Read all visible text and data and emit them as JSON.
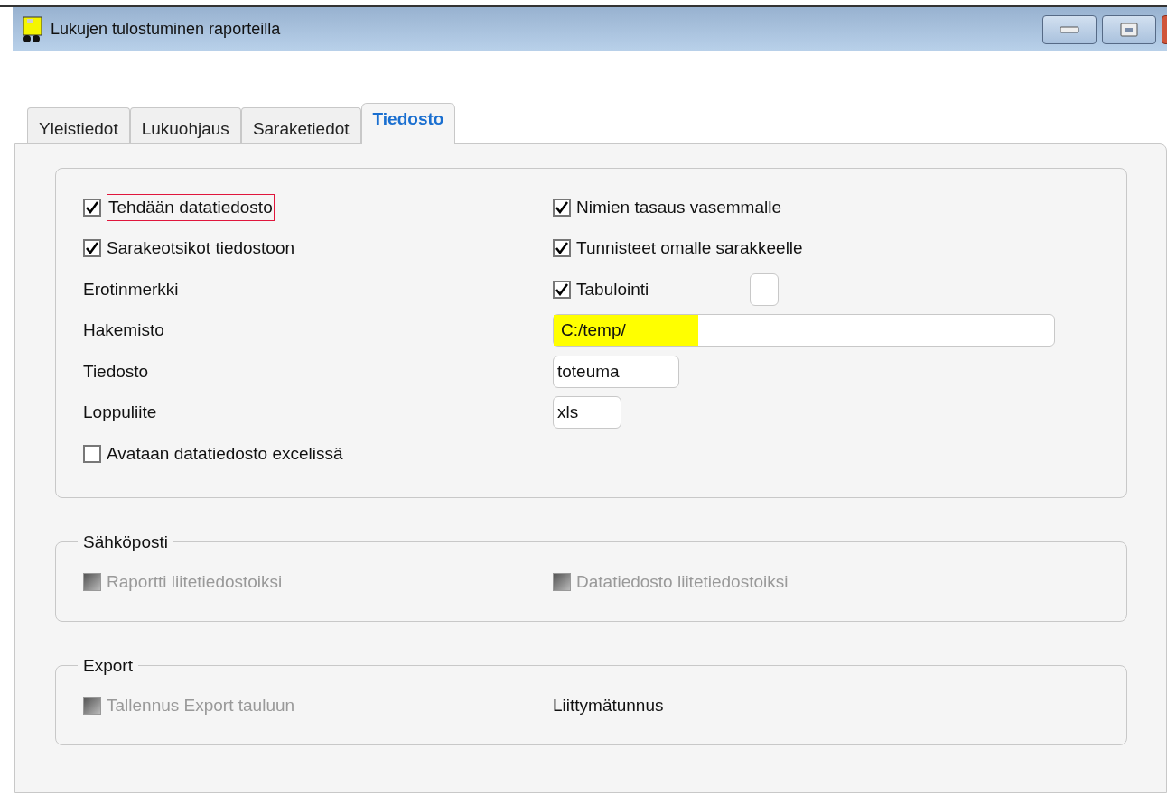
{
  "window": {
    "title": "Lukujen tulostuminen raporteilla"
  },
  "tabs": [
    {
      "label": "Yleistiedot",
      "selected": false
    },
    {
      "label": "Lukuohjaus",
      "selected": false
    },
    {
      "label": "Saraketiedot",
      "selected": false
    },
    {
      "label": "Tiedosto",
      "selected": true
    }
  ],
  "file_group": {
    "rows": [
      {
        "left": {
          "kind": "checkbox",
          "label": "Tehdään datatiedosto",
          "checked": true,
          "focused": true
        },
        "right": {
          "kind": "checkbox",
          "label": "Nimien tasaus vasemmalle",
          "checked": true
        }
      },
      {
        "left": {
          "kind": "checkbox",
          "label": "Sarakeotsikot tiedostoon",
          "checked": true
        },
        "right": {
          "kind": "checkbox",
          "label": "Tunnisteet omalle sarakkeelle",
          "checked": true
        }
      },
      {
        "left": {
          "kind": "label",
          "label": "Erotinmerkki"
        },
        "right": {
          "kind": "checkbox",
          "label": "Tabulointi",
          "checked": true,
          "extra_field": true
        }
      },
      {
        "left": {
          "kind": "label",
          "label": "Hakemisto"
        },
        "right": {
          "kind": "field",
          "value": "C:/temp/",
          "highlighted": true
        }
      },
      {
        "left": {
          "kind": "label",
          "label": "Tiedosto"
        },
        "right": {
          "kind": "field",
          "value": "toteuma"
        }
      },
      {
        "left": {
          "kind": "label",
          "label": "Loppuliite"
        },
        "right": {
          "kind": "field",
          "value": "xls"
        }
      },
      {
        "left": {
          "kind": "checkbox",
          "label": "Avataan datatiedosto excelissä",
          "checked": false
        }
      }
    ]
  },
  "email_group": {
    "title": "Sähköposti",
    "left": {
      "kind": "checkbox",
      "label": "Raportti liitetiedostoiksi",
      "checked": false,
      "disabled": true
    },
    "right": {
      "kind": "checkbox",
      "label": "Datatiedosto liitetiedostoiksi",
      "checked": false,
      "disabled": true
    }
  },
  "export_group": {
    "title": "Export",
    "left": {
      "kind": "checkbox",
      "label": "Tallennus Export tauluun",
      "checked": false,
      "disabled": true
    },
    "right": {
      "kind": "label",
      "label": "Liittymätunnus"
    }
  }
}
